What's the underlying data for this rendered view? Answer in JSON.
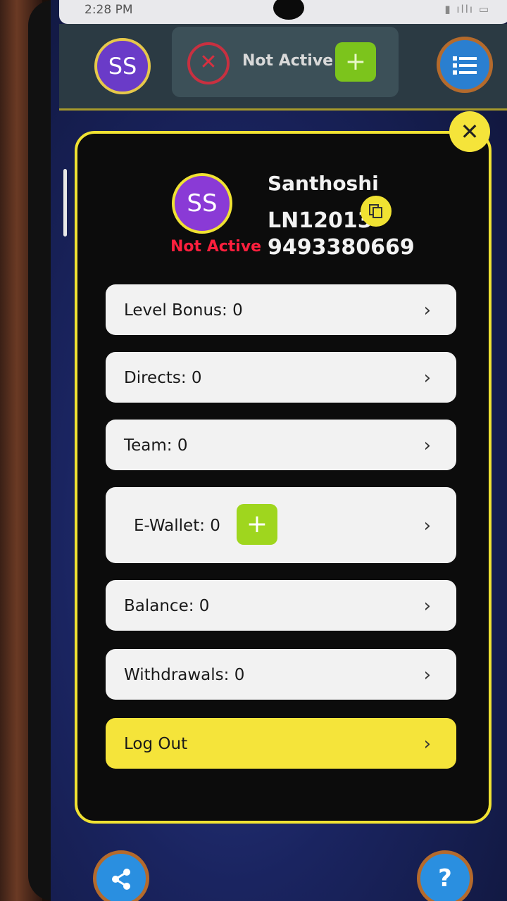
{
  "status_bar": {
    "time": "2:28 PM",
    "icons": "▮ ıllı ▭"
  },
  "header": {
    "avatar_initials": "SS",
    "activation_status": "Not Active",
    "close_symbol": "✕",
    "add_symbol": "+",
    "menu_icon": "list-icon"
  },
  "profile": {
    "avatar_initials": "SS",
    "status": "Not Active",
    "name": "Santhoshi",
    "user_id": "LN12013",
    "phone": "9493380669",
    "copy_icon": "copy-icon"
  },
  "menu": {
    "level_bonus": "Level Bonus: 0",
    "directs": "Directs: 0",
    "team": "Team: 0",
    "ewallet": "E-Wallet: 0",
    "balance": "Balance: 0",
    "withdrawals": "Withdrawals: 0",
    "logout": "Log Out",
    "chevron": "›",
    "plus": "+"
  },
  "footer": {
    "share_icon": "share-icon",
    "help_symbol": "?"
  },
  "colors": {
    "accent_yellow": "#f0e232",
    "status_red": "#ff1f3d",
    "add_green": "#7cc41c",
    "avatar_purple": "#8a3ad6"
  }
}
